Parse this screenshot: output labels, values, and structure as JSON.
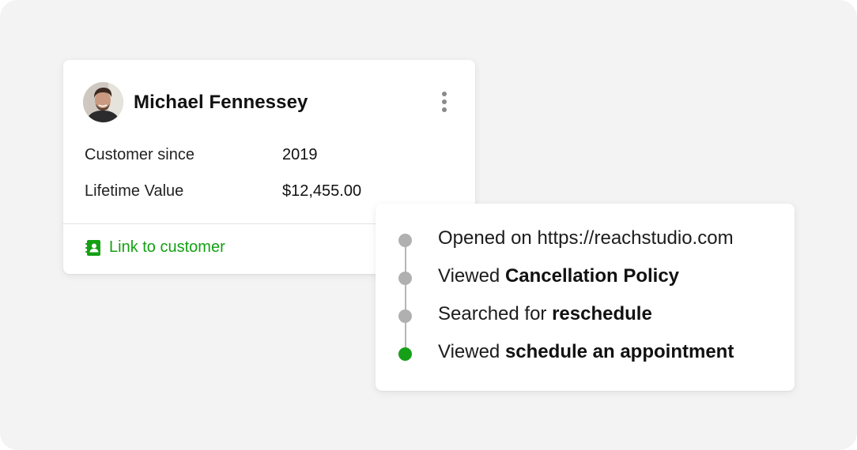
{
  "customer": {
    "name": "Michael Fennessey",
    "fields": [
      {
        "label": "Customer since",
        "value": "2019"
      },
      {
        "label": "Lifetime Value",
        "value": "$12,455.00"
      }
    ],
    "link_label": "Link to customer",
    "menu_icon": "more-vertical-icon",
    "link_icon": "contact-book-icon"
  },
  "activity": {
    "items": [
      {
        "prefix": "Opened on https://reachstudio.com",
        "emphasis": "",
        "state": "past"
      },
      {
        "prefix": "Viewed ",
        "emphasis": "Cancellation Policy",
        "state": "past"
      },
      {
        "prefix": "Searched for ",
        "emphasis": "reschedule",
        "state": "past"
      },
      {
        "prefix": "Viewed ",
        "emphasis": "schedule an appointment",
        "state": "current"
      }
    ]
  },
  "colors": {
    "accent_green": "#16a018",
    "dot_gray": "#b0b0b0",
    "background": "#f3f3f3"
  }
}
